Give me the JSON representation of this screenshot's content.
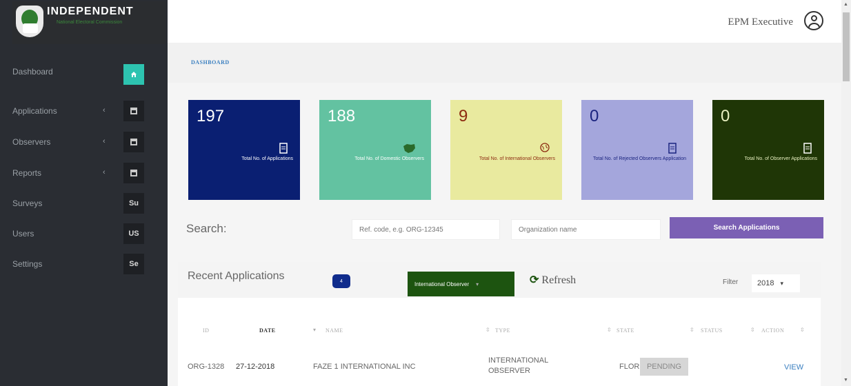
{
  "brand": {
    "title": "INDEPENDENT",
    "subtitle": "National Electoral Commission"
  },
  "sidebar": {
    "items": [
      {
        "label": "Dashboard",
        "badge": "",
        "icon": "home-icon"
      },
      {
        "label": "Applications",
        "badge": "",
        "icon": "table-icon"
      },
      {
        "label": "Observers",
        "badge": "",
        "icon": "table-icon"
      },
      {
        "label": "Reports",
        "badge": "",
        "icon": "table-icon"
      },
      {
        "label": "Surveys",
        "badge": "Su"
      },
      {
        "label": "Users",
        "badge": "US"
      },
      {
        "label": "Settings",
        "badge": "Se"
      }
    ],
    "chevron": "‹"
  },
  "header": {
    "user_name": "EPM Executive"
  },
  "breadcrumb": {
    "label": "DASHBOARD"
  },
  "cards": [
    {
      "value": "197",
      "label": "Total No. of Applications",
      "color": "#0a1f72",
      "text_color": "#ffffff"
    },
    {
      "value": "188",
      "label": "Total No. of Domestic Observers",
      "color": "#63c2a1",
      "text_color": "#ffffff"
    },
    {
      "value": "9",
      "label": "Total No. of International Observers",
      "color": "#e9ea9f",
      "text_color": "#8c2a10"
    },
    {
      "value": "0",
      "label": "Total No. of Rejected Observers Application",
      "color": "#a4a6dc",
      "text_color": "#1a237e"
    },
    {
      "value": "0",
      "label": "Total No. of Observer Applications",
      "color": "#1f3606",
      "text_color": "#e8f0c0"
    }
  ],
  "search": {
    "label": "Search:",
    "ref_placeholder": "Ref. code, e.g. ORG-12345",
    "org_placeholder": "Organization name",
    "button_label": "Search Applications"
  },
  "recent": {
    "title": "Recent Applications",
    "pill_label": "4",
    "observer_filter": "International Observer",
    "refresh_label": "Refresh",
    "filter_label": "Filter",
    "year": "2018"
  },
  "table": {
    "headers": [
      "ID",
      "DATE",
      "NAME",
      "TYPE",
      "STATE",
      "STATUS",
      "ACTION"
    ],
    "rows": [
      {
        "id": "ORG-1328",
        "date": "27-12-2018",
        "name": "FAZE 1 INTERNATIONAL INC",
        "type_line1": "INTERNATIONAL",
        "type_line2": "OBSERVER",
        "state": "FLORIDA",
        "status": "PENDING",
        "action": "VIEW"
      }
    ]
  },
  "colors": {
    "sidebar_bg": "#2a2d33",
    "accent_teal": "#2dc3b0",
    "search_button": "#7b60b4",
    "observer_green": "#1d5410",
    "link_blue": "#3a7fc0"
  }
}
